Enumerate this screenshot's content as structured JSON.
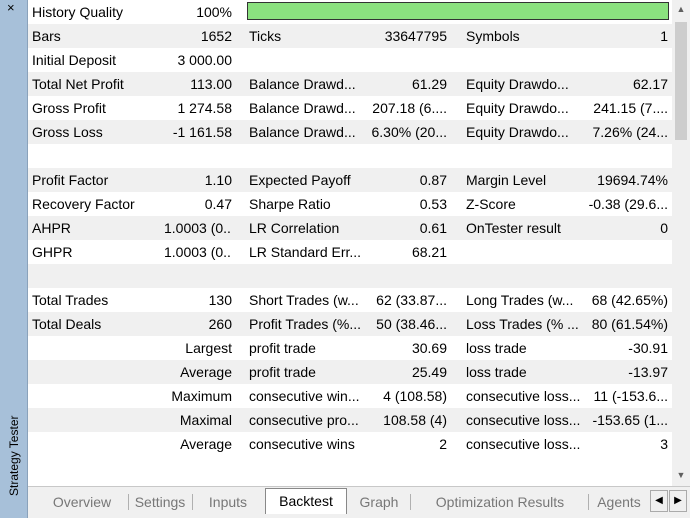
{
  "sidebar": {
    "title": "Strategy Tester",
    "close_icon": "×"
  },
  "history": {
    "label": "History Quality",
    "value": "100%",
    "quality_percent": 100,
    "bar_color": "#8be17f"
  },
  "rows": [
    {
      "c1": "Bars",
      "c2": "1652",
      "c3": "Ticks",
      "c4": "33647795",
      "c5": "Symbols",
      "c6": "1"
    },
    {
      "c1": "Initial Deposit",
      "c2": "3 000.00",
      "c3": "",
      "c4": "",
      "c5": "",
      "c6": ""
    },
    {
      "c1": "Total Net Profit",
      "c2": "113.00",
      "c3": "Balance Drawd...",
      "c4": "61.29",
      "c5": "Equity Drawdo...",
      "c6": "62.17"
    },
    {
      "c1": "Gross Profit",
      "c2": "1 274.58",
      "c3": "Balance Drawd...",
      "c4": "207.18 (6....",
      "c5": "Equity Drawdo...",
      "c6": "241.15 (7...."
    },
    {
      "c1": "Gross Loss",
      "c2": "-1 161.58",
      "c3": "Balance Drawd...",
      "c4": "6.30% (20...",
      "c5": "Equity Drawdo...",
      "c6": "7.26% (24..."
    },
    {
      "c1": "",
      "c2": "",
      "c3": "",
      "c4": "",
      "c5": "",
      "c6": ""
    },
    {
      "c1": "Profit Factor",
      "c2": "1.10",
      "c3": "Expected Payoff",
      "c4": "0.87",
      "c5": "Margin Level",
      "c6": "19694.74%"
    },
    {
      "c1": "Recovery Factor",
      "c2": "0.47",
      "c3": "Sharpe Ratio",
      "c4": "0.53",
      "c5": "Z-Score",
      "c6": "-0.38 (29.6..."
    },
    {
      "c1": "AHPR",
      "c2": "1.0003 (0....",
      "c3": "LR Correlation",
      "c4": "0.61",
      "c5": "OnTester result",
      "c6": "0"
    },
    {
      "c1": "GHPR",
      "c2": "1.0003 (0....",
      "c3": "LR Standard Err...",
      "c4": "68.21",
      "c5": "",
      "c6": ""
    },
    {
      "c1": "",
      "c2": "",
      "c3": "",
      "c4": "",
      "c5": "",
      "c6": ""
    },
    {
      "c1": "Total Trades",
      "c2": "130",
      "c3": "Short Trades (w...",
      "c4": "62 (33.87...",
      "c5": "Long Trades (w...",
      "c6": "68 (42.65%)"
    },
    {
      "c1": "Total Deals",
      "c2": "260",
      "c3": "Profit Trades (%...",
      "c4": "50 (38.46...",
      "c5": "Loss Trades (% ...",
      "c6": "80 (61.54%)"
    }
  ],
  "trade_rows": [
    {
      "label": "Largest",
      "c3": "profit trade",
      "c4": "30.69",
      "c5": "loss trade",
      "c6": "-30.91"
    },
    {
      "label": "Average",
      "c3": "profit trade",
      "c4": "25.49",
      "c5": "loss trade",
      "c6": "-13.97"
    },
    {
      "label": "Maximum",
      "c3": "consecutive win...",
      "c4": "4 (108.58)",
      "c5": "consecutive loss...",
      "c6": "11 (-153.6..."
    },
    {
      "label": "Maximal",
      "c3": "consecutive pro...",
      "c4": "108.58 (4)",
      "c5": "consecutive loss...",
      "c6": "-153.65 (1..."
    },
    {
      "label": "Average",
      "c3": "consecutive wins",
      "c4": "2",
      "c5": "consecutive loss...",
      "c6": "3"
    }
  ],
  "tabs": [
    "Overview",
    "Settings",
    "Inputs",
    "Backtest",
    "Graph",
    "Optimization Results",
    "Agents"
  ],
  "active_tab": "Backtest",
  "scroll": {
    "up_icon": "▲",
    "down_icon": "▼",
    "left_icon": "◀",
    "right_icon": "▶"
  }
}
